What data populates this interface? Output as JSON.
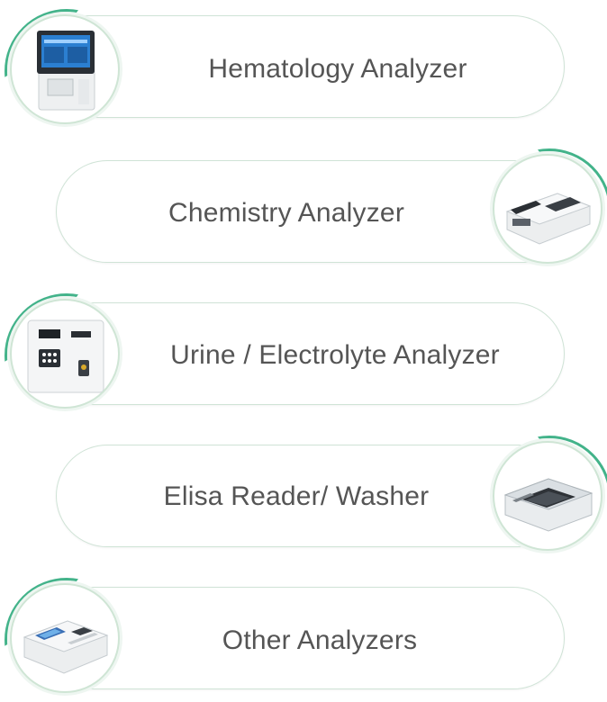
{
  "items": [
    {
      "label": "Hematology Analyzer",
      "icon": "hematology-analyzer-icon"
    },
    {
      "label": "Chemistry Analyzer",
      "icon": "chemistry-analyzer-icon"
    },
    {
      "label": "Urine / Electrolyte Analyzer",
      "icon": "electrolyte-analyzer-icon"
    },
    {
      "label": "Elisa Reader/ Washer",
      "icon": "elisa-reader-icon"
    },
    {
      "label": "Other Analyzers",
      "icon": "other-analyzer-icon"
    }
  ],
  "colors": {
    "accent": "#43b38a",
    "outline": "#cfe3d6",
    "text": "#555555"
  }
}
